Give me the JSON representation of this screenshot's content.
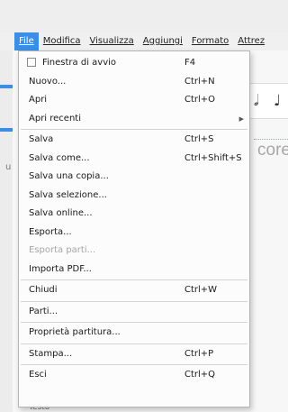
{
  "menubar": {
    "items": [
      {
        "label": "File",
        "active": true
      },
      {
        "label": "Modifica"
      },
      {
        "label": "Visualizza"
      },
      {
        "label": "Aggiungi"
      },
      {
        "label": "Formato"
      },
      {
        "label": "Attrez"
      }
    ]
  },
  "file_menu": {
    "avvio": {
      "label": "Finestra di avvio",
      "shortcut": "F4"
    },
    "nuovo": {
      "label": "Nuovo...",
      "shortcut": "Ctrl+N"
    },
    "apri": {
      "label": "Apri",
      "shortcut": "Ctrl+O"
    },
    "apri_recenti": {
      "label": "Apri recenti"
    },
    "salva": {
      "label": "Salva",
      "shortcut": "Ctrl+S"
    },
    "salva_come": {
      "label": "Salva come...",
      "shortcut": "Ctrl+Shift+S"
    },
    "salva_copia": {
      "label": "Salva una copia..."
    },
    "salva_selezione": {
      "label": "Salva selezione..."
    },
    "salva_online": {
      "label": "Salva online..."
    },
    "esporta": {
      "label": "Esporta..."
    },
    "esporta_parti": {
      "label": "Esporta parti..."
    },
    "importa_pdf": {
      "label": "Importa PDF..."
    },
    "chiudi": {
      "label": "Chiudi",
      "shortcut": "Ctrl+W"
    },
    "parti": {
      "label": "Parti..."
    },
    "proprieta": {
      "label": "Proprietà partitura..."
    },
    "stampa": {
      "label": "Stampa...",
      "shortcut": "Ctrl+P"
    },
    "esci": {
      "label": "Esci",
      "shortcut": "Ctrl+Q"
    }
  },
  "background": {
    "score_word": "core",
    "left_char": "u",
    "bottom_text": "Testo",
    "note1": "𝅗𝅥",
    "note2": "♩"
  }
}
